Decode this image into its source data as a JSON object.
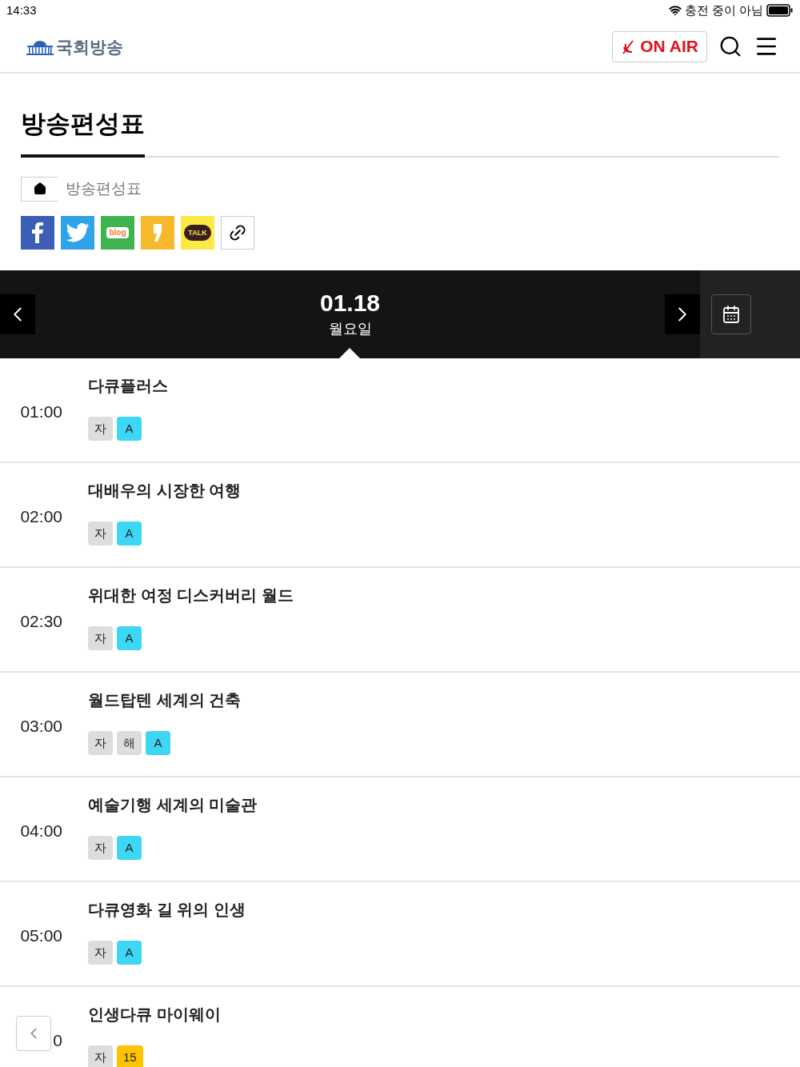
{
  "status_bar": {
    "time": "14:33",
    "charging": "충전 중이 아님"
  },
  "header": {
    "logo": "국회방송",
    "on_air": "ON AIR"
  },
  "page_title": "방송편성표",
  "breadcrumb": [
    "방송편성표"
  ],
  "share_buttons": [
    {
      "kind": "facebook"
    },
    {
      "kind": "twitter"
    },
    {
      "kind": "blog",
      "label": "blog"
    },
    {
      "kind": "kakaostory"
    },
    {
      "kind": "kakaotalk",
      "label": "TALK"
    },
    {
      "kind": "link"
    }
  ],
  "date_bar": {
    "date": "01.18",
    "weekday": "월요일"
  },
  "programs": [
    {
      "time": "01:00",
      "title": "다큐플러스",
      "tags": [
        {
          "label": "자",
          "color": "#dddddd"
        },
        {
          "label": "A",
          "color": "#3dd6f5"
        }
      ]
    },
    {
      "time": "02:00",
      "title": "대배우의 시장한 여행",
      "tags": [
        {
          "label": "자",
          "color": "#dddddd"
        },
        {
          "label": "A",
          "color": "#3dd6f5"
        }
      ]
    },
    {
      "time": "02:30",
      "title": "위대한 여정 디스커버리 월드",
      "tags": [
        {
          "label": "자",
          "color": "#dddddd"
        },
        {
          "label": "A",
          "color": "#3dd6f5"
        }
      ]
    },
    {
      "time": "03:00",
      "title": "월드탑텐 세계의 건축",
      "tags": [
        {
          "label": "자",
          "color": "#dddddd"
        },
        {
          "label": "해",
          "color": "#dddddd"
        },
        {
          "label": "A",
          "color": "#3dd6f5"
        }
      ]
    },
    {
      "time": "04:00",
      "title": "예술기행 세계의 미술관",
      "tags": [
        {
          "label": "자",
          "color": "#dddddd"
        },
        {
          "label": "A",
          "color": "#3dd6f5"
        }
      ]
    },
    {
      "time": "05:00",
      "title": "다큐영화 길 위의 인생",
      "tags": [
        {
          "label": "자",
          "color": "#dddddd"
        },
        {
          "label": "A",
          "color": "#3dd6f5"
        }
      ]
    },
    {
      "time": "0",
      "title": "인생다큐 마이웨이",
      "tags": [
        {
          "label": "자",
          "color": "#dddddd"
        },
        {
          "label": "15",
          "color": "#ffc300"
        }
      ]
    }
  ]
}
